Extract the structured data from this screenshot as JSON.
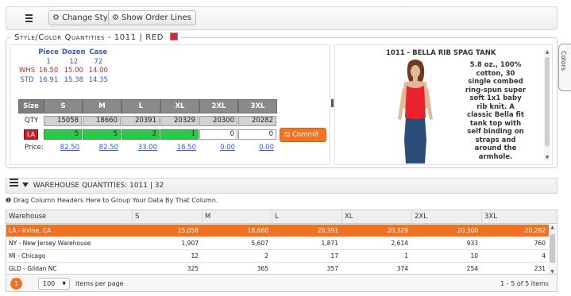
{
  "toolbar": {
    "change_style_label": "Change Style",
    "show_order_lines_label": "Show Order Lines"
  },
  "side_tab": {
    "colors_label": "Colors"
  },
  "style_color": {
    "legend_prefix": "Style/Color Quantities",
    "style": "1011",
    "separator": "|",
    "color_name": "RED",
    "color_swatch": "#d6263b"
  },
  "price_table": {
    "headers": [
      "Piece",
      "Dozen",
      "Case"
    ],
    "qty_row": [
      "1",
      "12",
      "72"
    ],
    "whs": {
      "label": "WHS",
      "values": [
        "16.50",
        "15.00",
        "14.00"
      ]
    },
    "std": {
      "label": "STD",
      "values": [
        "16.91",
        "15.38",
        "14.35"
      ]
    }
  },
  "size_grid": {
    "size_label": "Size",
    "qty_label": "QTY",
    "warehouse_label": "LA",
    "price_label": "Price:",
    "sizes": [
      "S",
      "M",
      "L",
      "XL",
      "2XL",
      "3XL"
    ],
    "qty": [
      "15058",
      "18660",
      "20391",
      "20329",
      "20300",
      "20282"
    ],
    "inputs": [
      "5",
      "5",
      "2",
      "1",
      "0",
      "0"
    ],
    "prices": [
      "82.50",
      "82.50",
      "33.00",
      "16.50",
      "0.00",
      "0.00"
    ],
    "commit_label": "Commit"
  },
  "product": {
    "title": "1011 - BELLA RIB SPAG TANK",
    "description": "5.8 oz., 100% cotton, 30 single combed ring-spun super soft 1x1 baby rib knit. A classic Bella fit tank top with self binding on straps and around the armhole."
  },
  "warehouse_panel": {
    "title": "WAREHOUSE QUANTITIES: 1011 | 32",
    "group_hint": "Drag Column Headers Here to Group Your Data By That Column."
  },
  "warehouse_grid": {
    "columns": [
      "Warehouse",
      "S",
      "M",
      "L",
      "XL",
      "2XL",
      "3XL"
    ],
    "rows": [
      {
        "name": "LA - Irvine, CA",
        "values": [
          "15,058",
          "18,660",
          "20,391",
          "20,329",
          "20,300",
          "20,282"
        ]
      },
      {
        "name": "NY - New Jersey Warehouse",
        "values": [
          "1,907",
          "5,607",
          "1,871",
          "2,614",
          "933",
          "760"
        ]
      },
      {
        "name": "MI - Chicago",
        "values": [
          "12",
          "2",
          "17",
          "1",
          "10",
          "4"
        ]
      },
      {
        "name": "GLD - Gildan NC",
        "values": [
          "325",
          "365",
          "357",
          "374",
          "254",
          "231"
        ]
      }
    ]
  },
  "pager": {
    "current_page": "1",
    "page_size": "100",
    "items_per_page_label": "items per page",
    "info": "1 - 5 of 5 items"
  },
  "colors": {
    "accent_orange": "#f07122",
    "input_green": "#2bc84b",
    "badge_red": "#c9222e",
    "link_blue": "#3358c8"
  }
}
